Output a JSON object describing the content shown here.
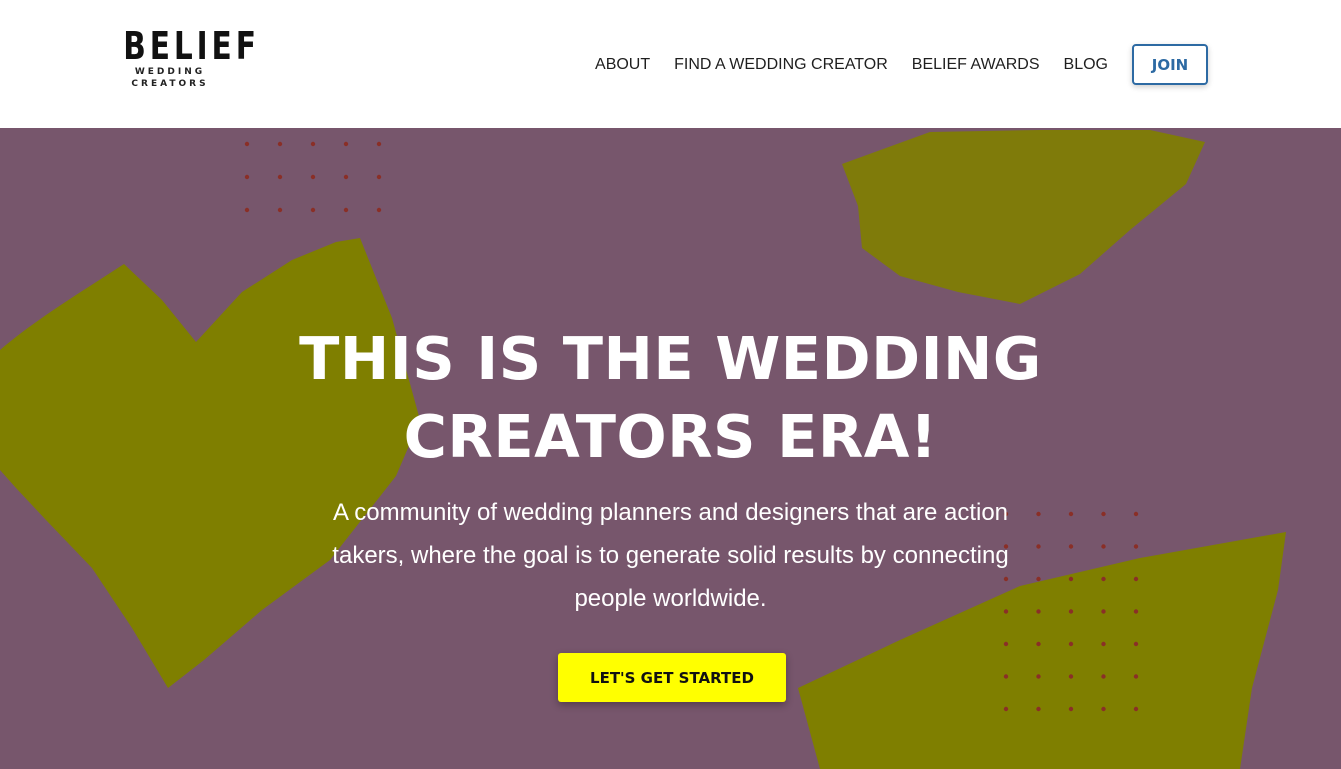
{
  "header": {
    "logo": {
      "main": "BELIEF",
      "line1": "WEDDING",
      "line2": "CREATORS"
    },
    "nav": [
      "ABOUT",
      "FIND A WEDDING CREATOR",
      "BELIEF AWARDS",
      "BLOG"
    ],
    "join_label": "JOIN"
  },
  "hero": {
    "title": "THIS IS THE WEDDING CREATORS ERA!",
    "subtitle": "A community of wedding planners and designers that are action takers, where the goal is to generate solid results by connecting people worldwide.",
    "cta_label": "LET'S GET STARTED"
  },
  "colors": {
    "hero_background": "#77566c",
    "brush_olive": "#7f7f00",
    "dot": "#8a2f27",
    "cta_yellow": "#ffff00",
    "join_blue": "#2d6aa3"
  }
}
